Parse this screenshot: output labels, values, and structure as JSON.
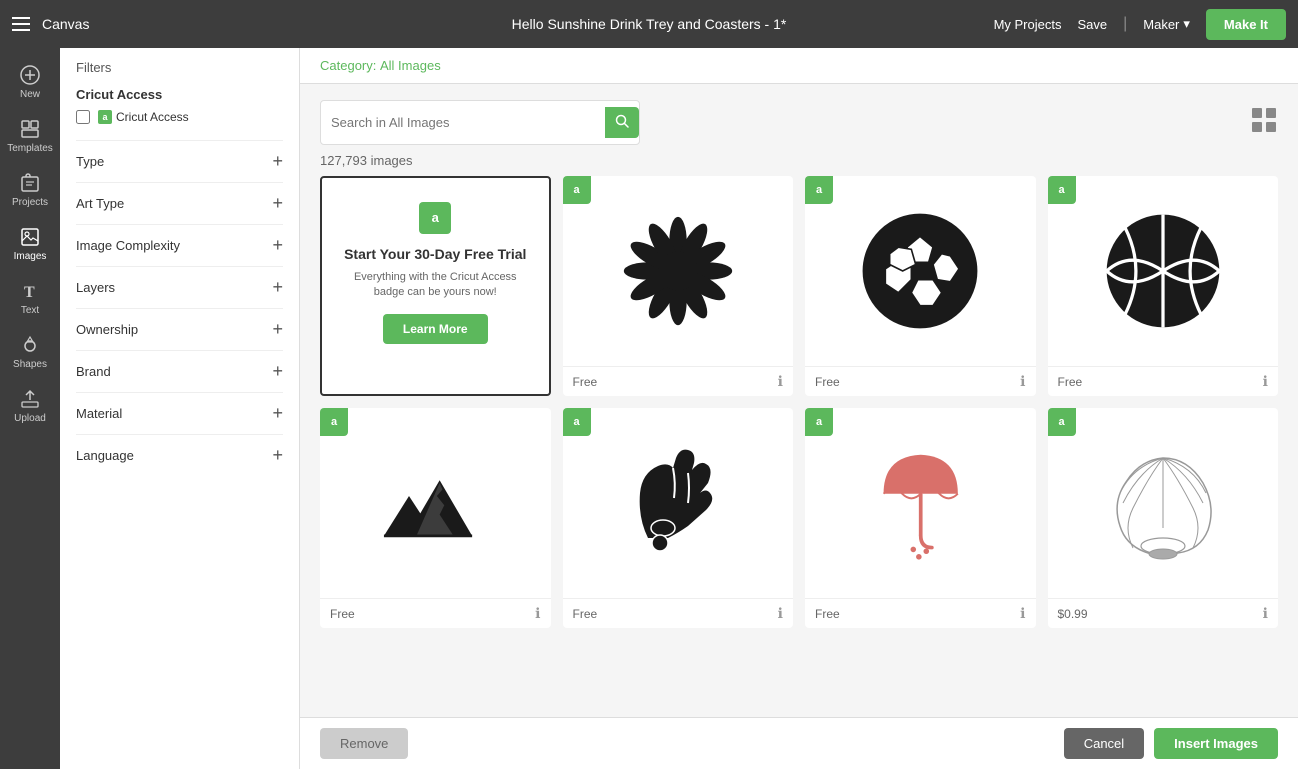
{
  "nav": {
    "title": "Canvas",
    "project_name": "Hello Sunshine Drink Trey and Coasters - 1*",
    "my_projects": "My Projects",
    "save": "Save",
    "maker": "Maker",
    "make_it": "Make It"
  },
  "icon_sidebar": {
    "items": [
      {
        "id": "new",
        "label": "New"
      },
      {
        "id": "templates",
        "label": "Templates"
      },
      {
        "id": "projects",
        "label": "Projects"
      },
      {
        "id": "images",
        "label": "Images"
      },
      {
        "id": "text",
        "label": "Text"
      },
      {
        "id": "shapes",
        "label": "Shapes"
      },
      {
        "id": "upload",
        "label": "Upload"
      }
    ]
  },
  "filter": {
    "title": "Filters",
    "cricut_access_section": "Cricut Access",
    "cricut_access_label": "Cricut Access",
    "filter_rows": [
      {
        "id": "type",
        "label": "Type"
      },
      {
        "id": "art_type",
        "label": "Art Type"
      },
      {
        "id": "image_complexity",
        "label": "Image Complexity"
      },
      {
        "id": "layers",
        "label": "Layers"
      },
      {
        "id": "ownership",
        "label": "Ownership"
      },
      {
        "id": "brand",
        "label": "Brand"
      },
      {
        "id": "material",
        "label": "Material"
      },
      {
        "id": "language",
        "label": "Language"
      }
    ]
  },
  "main": {
    "category_label": "Category:",
    "category_value": "All Images",
    "search_placeholder": "Search in All Images",
    "image_count": "127,793 images",
    "images": [
      {
        "id": "trial",
        "type": "trial",
        "title": "Start Your 30-Day Free Trial",
        "desc": "Everything with the Cricut Access badge can be yours now!",
        "btn": "Learn More",
        "selected": true
      },
      {
        "id": "sunflower",
        "type": "image",
        "price": "Free",
        "has_badge": true
      },
      {
        "id": "soccer",
        "type": "image",
        "price": "Free",
        "has_badge": true
      },
      {
        "id": "basketball",
        "type": "image",
        "price": "Free",
        "has_badge": true
      },
      {
        "id": "mountains",
        "type": "image",
        "price": "Free",
        "has_badge": true
      },
      {
        "id": "glove",
        "type": "image",
        "price": "Free",
        "has_badge": true
      },
      {
        "id": "umbrella",
        "type": "image",
        "price": "Free",
        "has_badge": true
      },
      {
        "id": "shell",
        "type": "image",
        "price": "$0.99",
        "has_badge": true
      }
    ]
  },
  "bottom": {
    "remove": "Remove",
    "cancel": "Cancel",
    "insert": "Insert Images"
  }
}
